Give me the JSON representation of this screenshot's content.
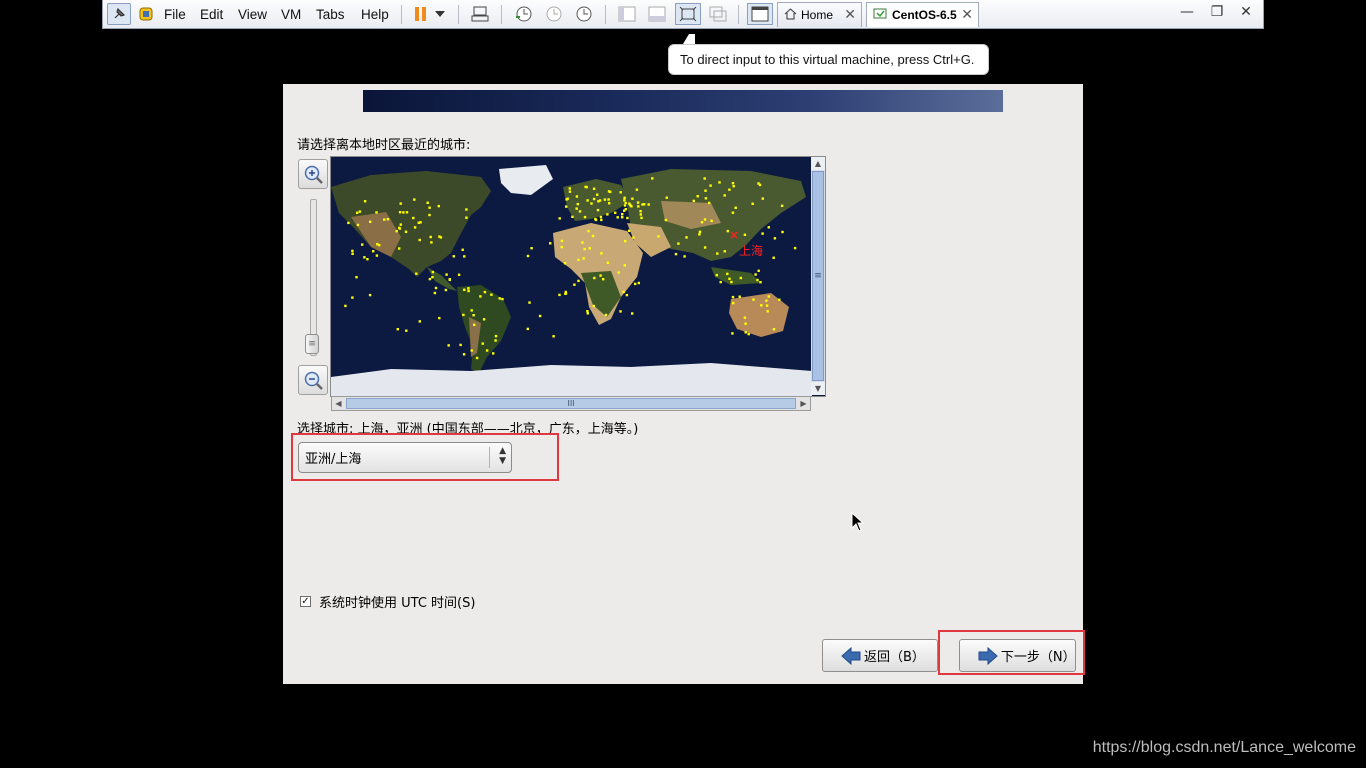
{
  "toolbar": {
    "menus": [
      "File",
      "Edit",
      "View",
      "VM",
      "Tabs",
      "Help"
    ],
    "tabs": [
      {
        "label": "Home",
        "close": "✕"
      },
      {
        "label": "CentOS-6.5",
        "close": "✕"
      }
    ],
    "window_controls": {
      "minimize": "—",
      "restore": "❐",
      "close": "✕"
    }
  },
  "tooltip": {
    "text": "To direct input to this virtual machine, press Ctrl+G."
  },
  "installer": {
    "heading": "请选择离本地时区最近的城市:",
    "map": {
      "selected_city_label": "上海",
      "marker": "×"
    },
    "selected_city_text": "选择城市: 上海，亚洲 (中国东部——北京，广东，上海等。)",
    "timezone_value": "亚洲/上海",
    "utc_checkbox": {
      "label": "系统时钟使用 UTC 时间(S)",
      "checked": true,
      "check_glyph": "✓"
    },
    "back_button": "返回（B）",
    "next_button": "下一步（N）",
    "scroll_grip": "≡",
    "hscroll_grip": "III"
  },
  "colors": {
    "highlight_red": "#e0383e",
    "city_dot": "#ffff00"
  },
  "watermark": "https://blog.csdn.net/Lance_welcome"
}
